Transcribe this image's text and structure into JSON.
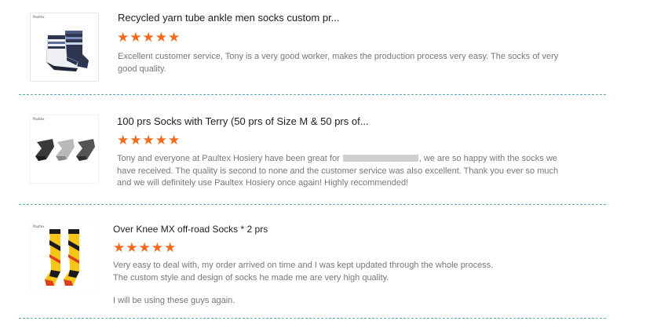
{
  "reviews": [
    {
      "brand": "Paultex",
      "title": "Recycled yarn tube ankle men socks custom pr...",
      "rating": 5,
      "text": "Excellent customer service, Tony is a very good worker, makes the production process very easy. The socks of very good quality."
    },
    {
      "brand": "Paultex",
      "title": "100 prs Socks with Terry (50 prs of Size M & 50 prs of...",
      "rating": 5,
      "text_before": "Tony and everyone at Paultex Hosiery have been great for",
      "text_after": ", we are so happy with the socks we have received. The quality is second to none and the customer service was also excellent. Thank you ever so much and we will definitely use Paultex Hosiery once again! Highly recommended!"
    },
    {
      "brand": "Paultex",
      "title": "Over Knee MX off-road Socks * 2 prs",
      "rating": 5,
      "text_line1": "Very easy to deal with, my order arrived on time and I was kept updated through the whole process.",
      "text_line2": "The custom style and design of socks he made me are very high quality.",
      "text_line3": "I will be using these guys again."
    }
  ],
  "star_glyph": "★",
  "colors": {
    "star": "#f26a1b",
    "divider": "#5aa8b8"
  }
}
